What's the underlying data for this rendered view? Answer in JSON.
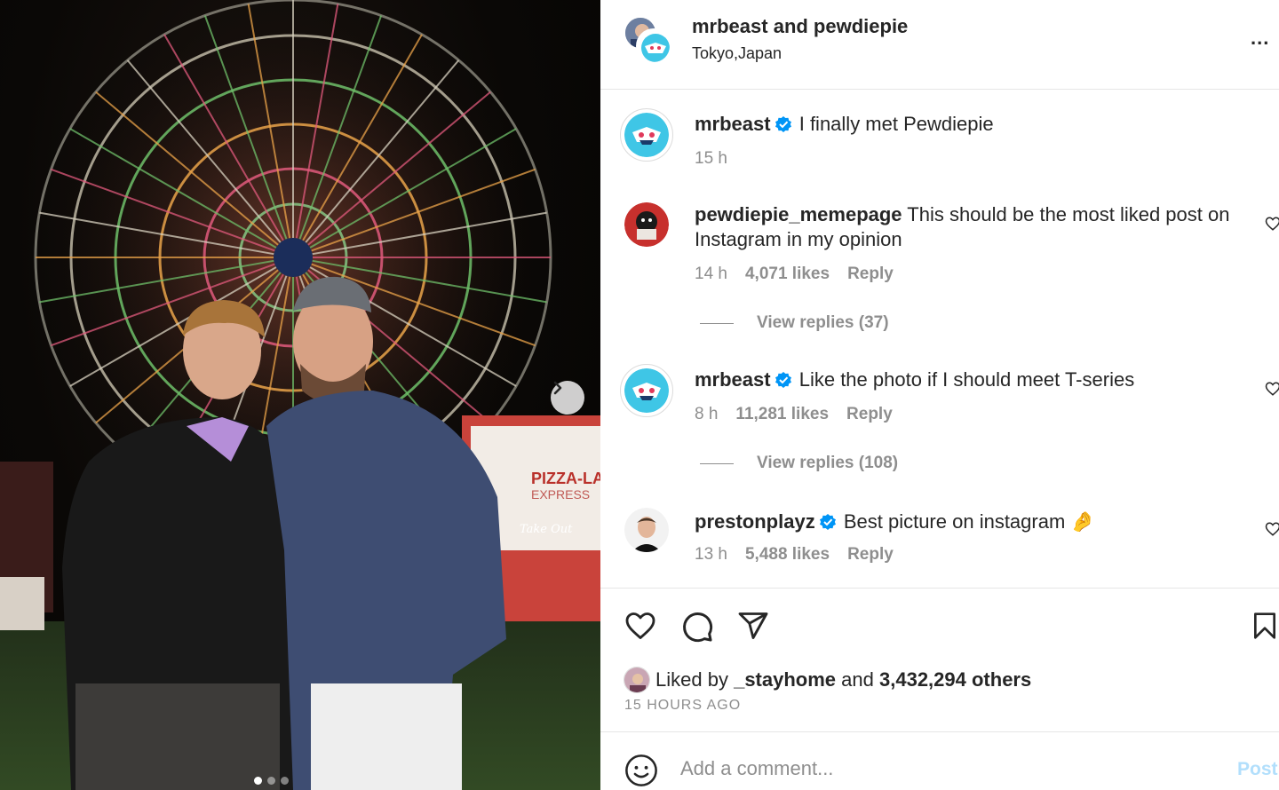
{
  "header": {
    "title": "mrbeast and pewdiepie",
    "location": "Tokyo,Japan",
    "more_label": "..."
  },
  "photo": {
    "sign_text": "PIZZA-LA",
    "sign_subtext": "EXPRESS",
    "sign_takeout": "Take Out",
    "carousel_dots": 3,
    "active_dot": 1
  },
  "caption": {
    "username": "mrbeast",
    "text": "I finally met Pewdiepie",
    "time": "15 h"
  },
  "comments": [
    {
      "username": "pewdiepie_memepage",
      "text": "This should be the most liked post on Instagram in my opinion",
      "time": "14 h",
      "likes": "4,071 likes",
      "reply": "Reply",
      "view_replies": "View replies (37)",
      "verified": false
    },
    {
      "username": "mrbeast",
      "text": "Like the photo if I should meet T-series",
      "time": "8 h",
      "likes": "11,281 likes",
      "reply": "Reply",
      "view_replies": "View replies (108)",
      "verified": true
    },
    {
      "username": "prestonplayz",
      "text": "Best picture on instagram 🤌",
      "time": "13 h",
      "likes": "5,488 likes",
      "reply": "Reply",
      "verified": true
    }
  ],
  "likes_summary": {
    "prefix": "Liked by",
    "user": "_stayhome",
    "joiner": "and",
    "others": "3,432,294 others"
  },
  "posted_ago": "15 HOURS AGO",
  "comment_box": {
    "placeholder": "Add a comment...",
    "post_label": "Post"
  },
  "colors": {
    "verified": "#0095f6",
    "post_disabled": "#b2dffc",
    "muted": "#8e8e8e"
  },
  "icons": [
    "more-icon",
    "heart-icon",
    "comment-icon",
    "share-icon",
    "bookmark-icon",
    "emoji-icon",
    "chevron-right-icon",
    "verified-icon"
  ]
}
